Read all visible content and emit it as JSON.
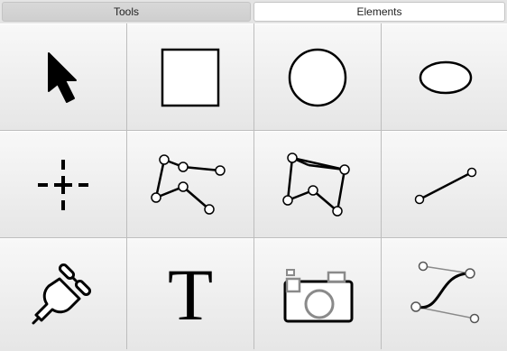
{
  "tabs": [
    {
      "label": "Tools",
      "selected": false
    },
    {
      "label": "Elements",
      "selected": true
    }
  ],
  "tools": [
    {
      "icon": "arrow-pointer-icon"
    },
    {
      "icon": "rectangle-icon"
    },
    {
      "icon": "circle-icon"
    },
    {
      "icon": "ellipse-icon"
    },
    {
      "icon": "crosshair-icon"
    },
    {
      "icon": "polyline-icon"
    },
    {
      "icon": "polygon-icon"
    },
    {
      "icon": "line-icon"
    },
    {
      "icon": "plug-icon"
    },
    {
      "icon": "text-icon",
      "glyph": "T"
    },
    {
      "icon": "camera-icon"
    },
    {
      "icon": "bezier-curve-icon"
    }
  ],
  "colors": {
    "stroke": "#000000",
    "handle_stroke": "#555555",
    "secondary_gray": "#8a8a8a"
  }
}
